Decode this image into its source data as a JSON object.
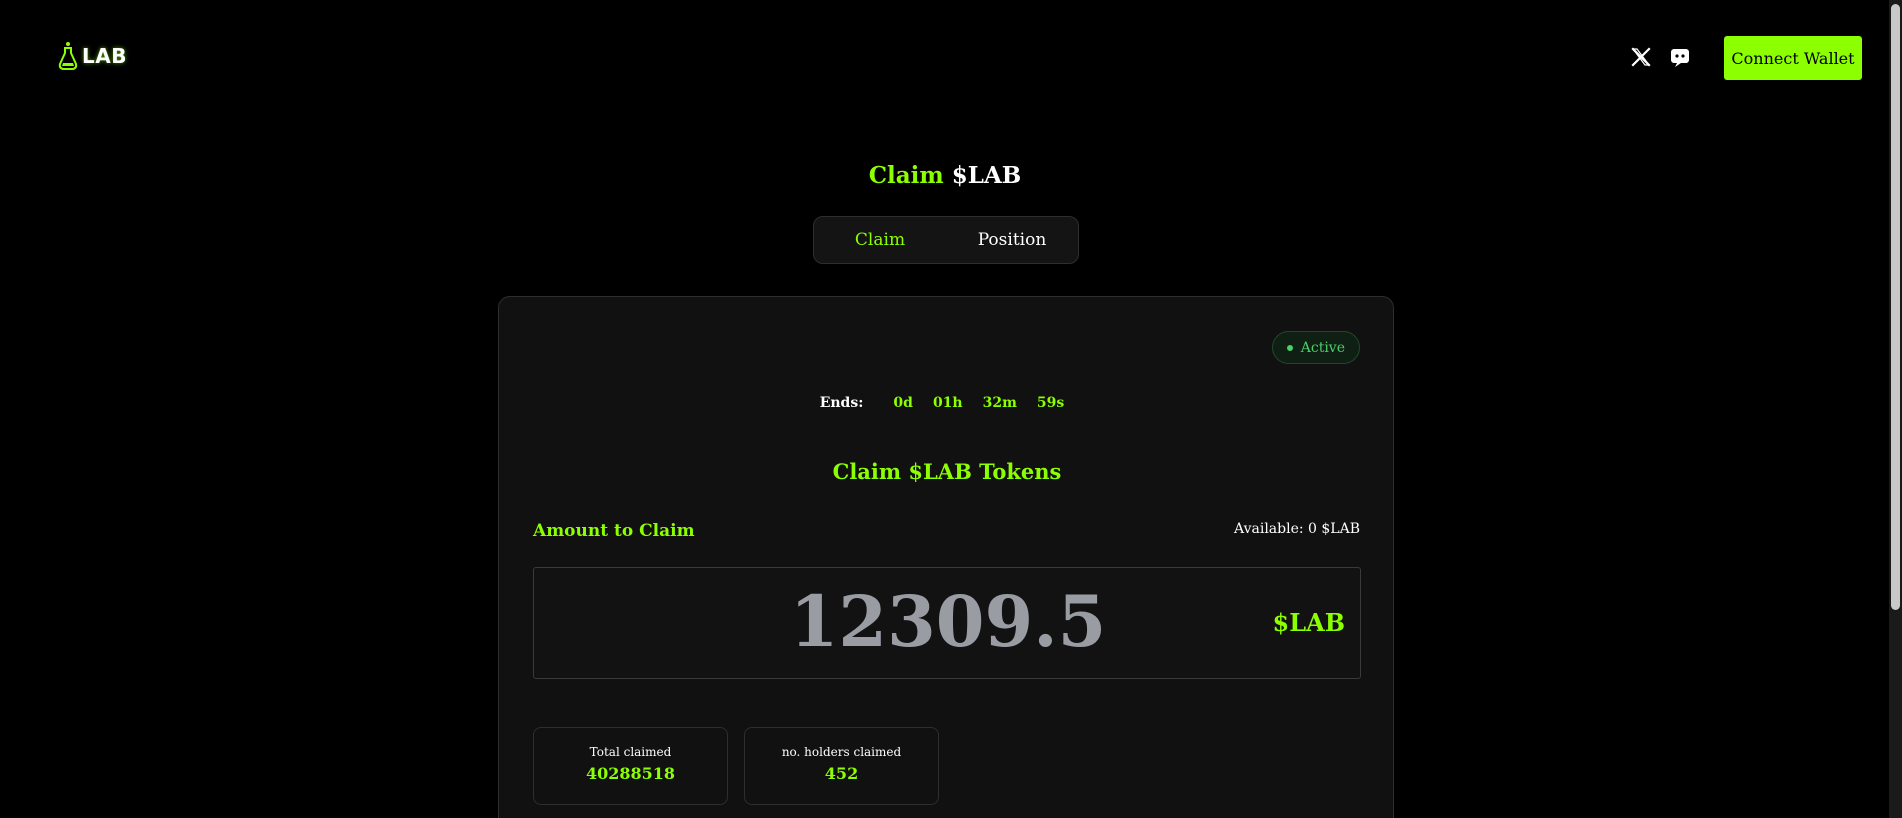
{
  "header": {
    "logo_text": "LAB",
    "connect_label": "Connect Wallet",
    "social_icons": [
      "x-icon",
      "discord-icon"
    ]
  },
  "title": {
    "accent": "Claim",
    "rest": "$LAB"
  },
  "tabs": [
    {
      "label": "Claim",
      "active": true
    },
    {
      "label": "Position",
      "active": false
    }
  ],
  "card": {
    "status": "Active",
    "countdown": {
      "label": "Ends:",
      "days": "0d",
      "hours": "01h",
      "minutes": "32m",
      "seconds": "59s"
    },
    "heading": "Claim $LAB Tokens",
    "amount_label": "Amount to Claim",
    "available": "Available: 0 $LAB",
    "amount_value": "12309.5",
    "amount_unit": "$LAB",
    "stats": [
      {
        "label": "Total claimed",
        "value": "40288518"
      },
      {
        "label": "no. holders claimed",
        "value": "452"
      }
    ]
  },
  "colors": {
    "accent": "#8cff00",
    "background": "#000000",
    "card": "#111111",
    "status_green": "#4ccf6a"
  }
}
